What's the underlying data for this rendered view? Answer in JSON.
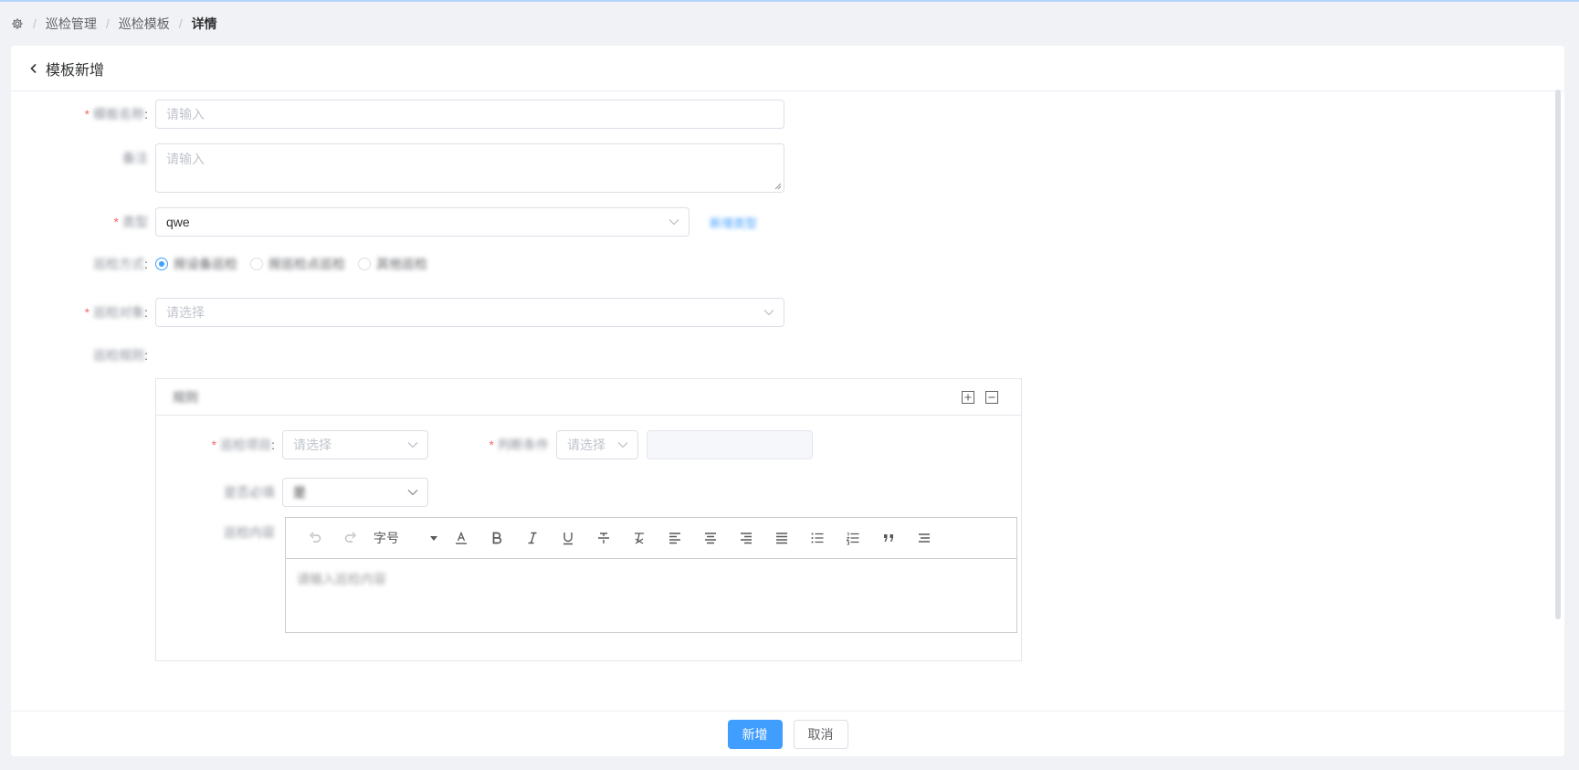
{
  "breadcrumb": {
    "items": [
      "巡检管理",
      "巡检模板"
    ],
    "current": "详情"
  },
  "header": {
    "title": "模板新增"
  },
  "form": {
    "name": {
      "label": "模板名称",
      "placeholder": "请输入"
    },
    "remark": {
      "label": "备注",
      "placeholder": "请输入"
    },
    "type": {
      "label": "类型",
      "value": "qwe",
      "link": "新增类型"
    },
    "mode": {
      "label": "巡检方式",
      "options": [
        "按设备巡检",
        "按巡检点巡检",
        "其他巡检"
      ],
      "selected_index": 0
    },
    "target": {
      "label": "巡检对象",
      "placeholder": "请选择"
    },
    "rules": {
      "label": "巡检规则",
      "tab_name": "规则",
      "item": {
        "label": "巡检项目",
        "placeholder": "请选择"
      },
      "condition": {
        "label": "判断条件",
        "placeholder": "请选择",
        "value": ""
      },
      "required": {
        "label": "是否必填",
        "value": "是"
      },
      "content": {
        "label": "巡检内容",
        "fontsize_label": "字号",
        "placeholder": "请输入巡检内容"
      }
    }
  },
  "footer": {
    "submit_label": "新增",
    "cancel_label": "取消"
  },
  "colors": {
    "primary": "#409eff",
    "required": "#f56c6c",
    "border": "#dcdfe6"
  }
}
